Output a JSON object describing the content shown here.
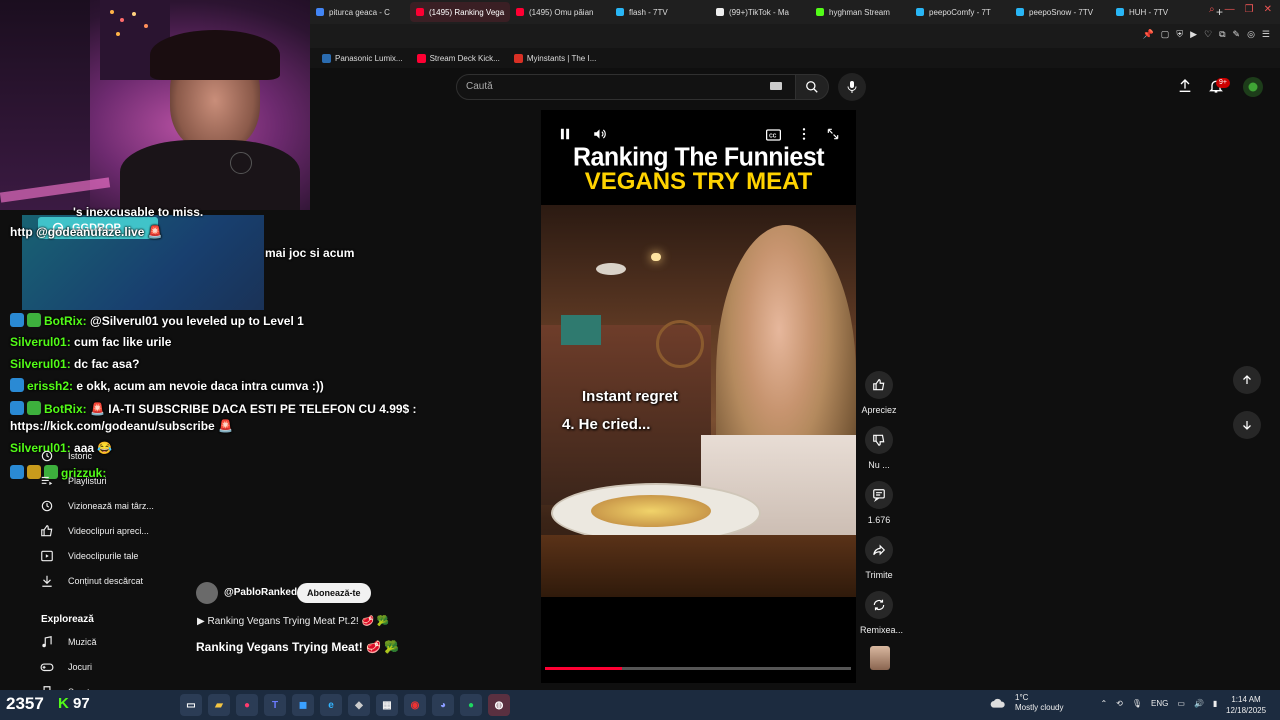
{
  "browser": {
    "tabs": [
      {
        "label": "piturca geaca - C",
        "color": "#4285f4",
        "active": false
      },
      {
        "label": "(1495) Ranking Vega",
        "color": "#ff0033",
        "active": true
      },
      {
        "label": "(1495) Omu păian",
        "color": "#ff0033",
        "active": false
      },
      {
        "label": "flash - 7TV",
        "color": "#29b6f6",
        "active": false
      },
      {
        "label": "(99+)TikTok - Ma",
        "color": "#eeeeee",
        "active": false
      },
      {
        "label": "hyghman Stream",
        "color": "#53fc18",
        "active": false
      },
      {
        "label": "peepoComfy - 7T",
        "color": "#29b6f6",
        "active": false
      },
      {
        "label": "peepoSnow - 7TV",
        "color": "#29b6f6",
        "active": false
      },
      {
        "label": "HUH - 7TV",
        "color": "#29b6f6",
        "active": false
      }
    ],
    "new_tab": "+",
    "bookmarks": [
      {
        "label": "Panasonic Lumix...",
        "color": "#2b6cb0"
      },
      {
        "label": "Stream Deck Kick...",
        "color": "#ff0033"
      },
      {
        "label": "Myinstants | The I...",
        "color": "#d93025"
      }
    ]
  },
  "youtube": {
    "search_placeholder": "Caută",
    "notification_count": "9+",
    "sidebar": [
      {
        "label": "Istoric",
        "icon": "history-icon"
      },
      {
        "label": "Playlisturi",
        "icon": "playlist-icon"
      },
      {
        "label": "Vizionează mai târz...",
        "icon": "clock-icon"
      },
      {
        "label": "Videoclipuri apreci...",
        "icon": "thumbs-up-icon"
      },
      {
        "label": "Videoclipurile tale",
        "icon": "video-icon"
      },
      {
        "label": "Conținut descărcat",
        "icon": "download-icon"
      }
    ],
    "explore_title": "Explorează",
    "explore_items": [
      {
        "label": "Muzică",
        "icon": "music-icon"
      },
      {
        "label": "Jocuri",
        "icon": "gamepad-icon"
      },
      {
        "label": "Sport",
        "icon": "trophy-icon"
      }
    ],
    "short": {
      "overlay_title_line1": "Ranking The Funniest",
      "overlay_title_line2": "VEGANS TRY MEAT",
      "caption1": "Instant regret",
      "caption2": "4. He cried...",
      "progress": 0.25,
      "channel": "@PabloRanked",
      "subscribe_label": "Abonează-te",
      "link_text": "▶ Ranking Vegans Trying Meat Pt.2! 🥩 🥦",
      "title": "Ranking Vegans Trying Meat! 🥩 🥦"
    },
    "actions": [
      {
        "label": "Apreciez",
        "icon": "like-icon"
      },
      {
        "label": "Nu ...",
        "icon": "dislike-icon"
      },
      {
        "label": "1.676",
        "icon": "comment-icon"
      },
      {
        "label": "Trimite",
        "icon": "share-icon"
      },
      {
        "label": "Remixea...",
        "icon": "remix-icon"
      }
    ]
  },
  "stream_overlay": {
    "ggdrop_label": "GGDROP",
    "chat": [
      {
        "user": "",
        "text": "'s inexcusable to miss.",
        "color": "#ffffff"
      },
      {
        "user": "http",
        "text": "@godeanufaze.live 🚨",
        "color": "#ffffff"
      },
      {
        "user": "",
        "text": "mai joc si acum",
        "color": "#ffffff"
      },
      {
        "user": "BotRix:",
        "text": "@Silverul01 you leveled up to Level 1",
        "color": "#53fc18"
      },
      {
        "user": "Silverul01:",
        "text": "cum fac like urile",
        "color": "#53fc18"
      },
      {
        "user": "Silverul01:",
        "text": "dc fac asa?",
        "color": "#53fc18"
      },
      {
        "user": "erissh2:",
        "text": "e okk, acum am nevoie daca intra cumva :))",
        "color": "#53fc18"
      },
      {
        "user": "BotRix:",
        "text": "🚨 IA-TI SUBSCRIBE DACA ESTI PE TELEFON CU 4.99$ :",
        "color": "#53fc18"
      },
      {
        "user": "",
        "text": "https://kick.com/godeanu/subscribe 🚨",
        "color": "#ffffff"
      },
      {
        "user": "Silverul01:",
        "text": "aaa 😂",
        "color": "#53fc18"
      },
      {
        "user": "grizzuk:",
        "text": "",
        "color": "#53fc18"
      }
    ],
    "viewers": "2357",
    "kick_count": "97"
  },
  "taskbar": {
    "weather_temp": "1°C",
    "weather_text": "Mostly cloudy",
    "language": "ENG",
    "time": "1:14 AM",
    "date": "12/18/2025"
  }
}
